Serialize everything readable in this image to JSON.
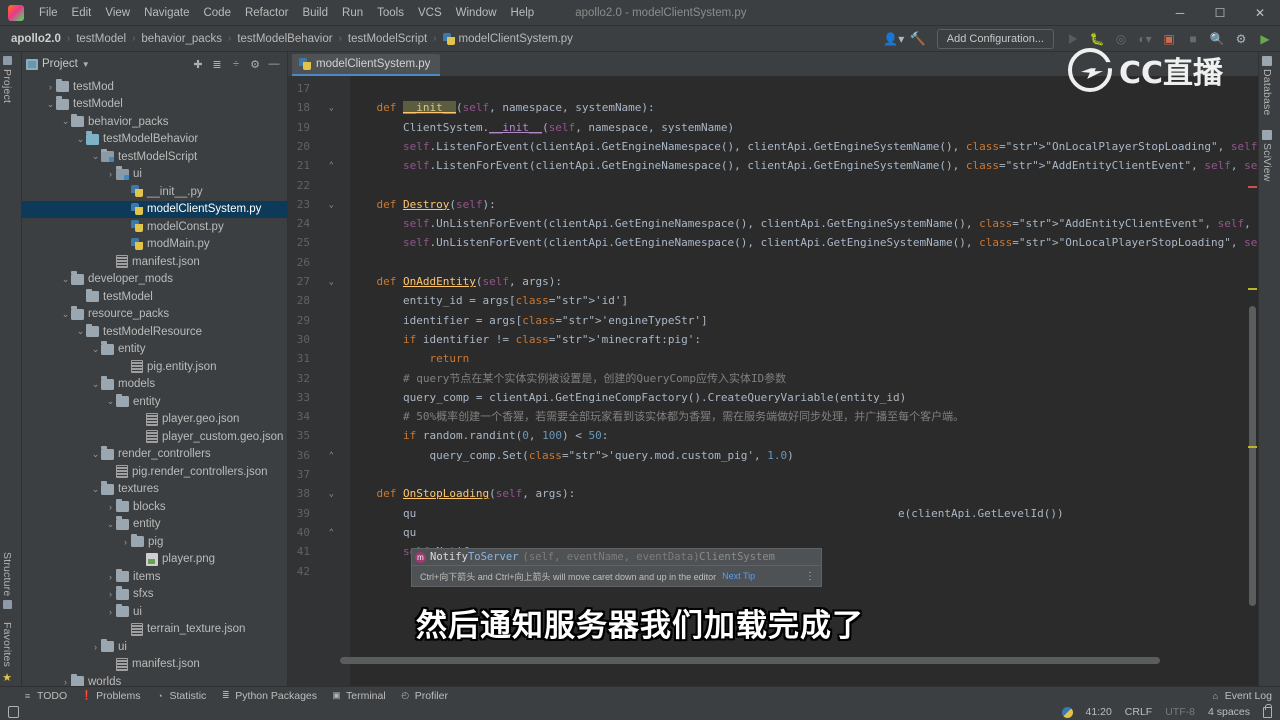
{
  "window": {
    "title": "apollo2.0 - modelClientSystem.py",
    "controls": [
      "─",
      "☐",
      "✕"
    ]
  },
  "menubar": {
    "items": [
      "File",
      "Edit",
      "View",
      "Navigate",
      "Code",
      "Refactor",
      "Build",
      "Run",
      "Tools",
      "VCS",
      "Window",
      "Help"
    ]
  },
  "breadcrumb": {
    "items": [
      "apollo2.0",
      "testModel",
      "behavior_packs",
      "testModelBehavior",
      "testModelScript"
    ],
    "file": "modelClientSystem.py",
    "separator": "›"
  },
  "toolbar": {
    "add_configuration": "Add Configuration...",
    "icons": [
      "user-avatar-icon",
      "hammer-icon",
      "run-icon",
      "debug-icon",
      "coverage-icon",
      "profile-icon",
      "stop-icon",
      "search-icon",
      "settings-icon",
      "plugin-icon"
    ]
  },
  "left_rail": {
    "items": [
      "Project",
      "Structure",
      "Favorites"
    ]
  },
  "right_rail": {
    "items": [
      "Database",
      "SciView"
    ]
  },
  "project_panel": {
    "title": "Project",
    "tools": [
      "scope-icon",
      "collapse-all-icon",
      "flatten-icon",
      "settings-icon",
      "hide-icon"
    ],
    "tree": [
      {
        "label": "testMod",
        "indent": 1,
        "arrow": "›",
        "kind": "folder"
      },
      {
        "label": "testModel",
        "indent": 1,
        "arrow": "∨",
        "kind": "folder"
      },
      {
        "label": "behavior_packs",
        "indent": 2,
        "arrow": "∨",
        "kind": "folder"
      },
      {
        "label": "testModelBehavior",
        "indent": 3,
        "arrow": "∨",
        "kind": "folder-blue"
      },
      {
        "label": "testModelScript",
        "indent": 4,
        "arrow": "∨",
        "kind": "folder-mod"
      },
      {
        "label": "ui",
        "indent": 5,
        "arrow": "›",
        "kind": "folder-mod"
      },
      {
        "label": "__init__.py",
        "indent": 6,
        "arrow": "",
        "kind": "py"
      },
      {
        "label": "modelClientSystem.py",
        "indent": 6,
        "arrow": "",
        "kind": "py",
        "selected": true
      },
      {
        "label": "modelConst.py",
        "indent": 6,
        "arrow": "",
        "kind": "py"
      },
      {
        "label": "modMain.py",
        "indent": 6,
        "arrow": "",
        "kind": "py"
      },
      {
        "label": "manifest.json",
        "indent": 5,
        "arrow": "",
        "kind": "json"
      },
      {
        "label": "developer_mods",
        "indent": 2,
        "arrow": "∨",
        "kind": "folder"
      },
      {
        "label": "testModel",
        "indent": 3,
        "arrow": "",
        "kind": "folder"
      },
      {
        "label": "resource_packs",
        "indent": 2,
        "arrow": "∨",
        "kind": "folder"
      },
      {
        "label": "testModelResource",
        "indent": 3,
        "arrow": "∨",
        "kind": "folder"
      },
      {
        "label": "entity",
        "indent": 4,
        "arrow": "∨",
        "kind": "folder"
      },
      {
        "label": "pig.entity.json",
        "indent": 6,
        "arrow": "",
        "kind": "json"
      },
      {
        "label": "models",
        "indent": 4,
        "arrow": "∨",
        "kind": "folder"
      },
      {
        "label": "entity",
        "indent": 5,
        "arrow": "∨",
        "kind": "folder"
      },
      {
        "label": "player.geo.json",
        "indent": 7,
        "arrow": "",
        "kind": "json"
      },
      {
        "label": "player_custom.geo.json",
        "indent": 7,
        "arrow": "",
        "kind": "json"
      },
      {
        "label": "render_controllers",
        "indent": 4,
        "arrow": "∨",
        "kind": "folder"
      },
      {
        "label": "pig.render_controllers.json",
        "indent": 5,
        "arrow": "",
        "kind": "json"
      },
      {
        "label": "textures",
        "indent": 4,
        "arrow": "∨",
        "kind": "folder"
      },
      {
        "label": "blocks",
        "indent": 5,
        "arrow": "›",
        "kind": "folder"
      },
      {
        "label": "entity",
        "indent": 5,
        "arrow": "∨",
        "kind": "folder"
      },
      {
        "label": "pig",
        "indent": 6,
        "arrow": "›",
        "kind": "folder"
      },
      {
        "label": "player.png",
        "indent": 7,
        "arrow": "",
        "kind": "png"
      },
      {
        "label": "items",
        "indent": 5,
        "arrow": "›",
        "kind": "folder"
      },
      {
        "label": "sfxs",
        "indent": 5,
        "arrow": "›",
        "kind": "folder"
      },
      {
        "label": "ui",
        "indent": 5,
        "arrow": "›",
        "kind": "folder"
      },
      {
        "label": "terrain_texture.json",
        "indent": 6,
        "arrow": "",
        "kind": "json"
      },
      {
        "label": "ui",
        "indent": 4,
        "arrow": "›",
        "kind": "folder"
      },
      {
        "label": "manifest.json",
        "indent": 5,
        "arrow": "",
        "kind": "json"
      },
      {
        "label": "worlds",
        "indent": 2,
        "arrow": "›",
        "kind": "folder"
      }
    ]
  },
  "editor": {
    "tab": "modelClientSystem.py",
    "first_line": 17,
    "lines": [
      {
        "n": 17,
        "text": "",
        "fold": ""
      },
      {
        "n": 18,
        "text": "    def __init__(self, namespace, systemName):",
        "fold": "⌄"
      },
      {
        "n": 19,
        "text": "        ClientSystem.__init__(self, namespace, systemName)",
        "fold": ""
      },
      {
        "n": 20,
        "text": "        self.ListenForEvent(clientApi.GetEngineNamespace(), clientApi.GetEngineSystemName(), \"OnLocalPlayerStopLoading\", self, self.OnStopLoading)",
        "fold": ""
      },
      {
        "n": 21,
        "text": "        self.ListenForEvent(clientApi.GetEngineNamespace(), clientApi.GetEngineSystemName(), \"AddEntityClientEvent\", self, self.OnAddEntity)",
        "fold": "⌃"
      },
      {
        "n": 22,
        "text": "",
        "fold": ""
      },
      {
        "n": 23,
        "text": "    def Destroy(self):",
        "fold": "⌄"
      },
      {
        "n": 24,
        "text": "        self.UnListenForEvent(clientApi.GetEngineNamespace(), clientApi.GetEngineSystemName(), \"AddEntityClientEvent\", self, self.OnAddEntity)",
        "fold": ""
      },
      {
        "n": 25,
        "text": "        self.UnListenForEvent(clientApi.GetEngineNamespace(), clientApi.GetEngineSystemName(), \"OnLocalPlayerStopLoading\", self, self.OnStopLoading)",
        "fold": ""
      },
      {
        "n": 26,
        "text": "",
        "fold": ""
      },
      {
        "n": 27,
        "text": "    def OnAddEntity(self, args):",
        "fold": "⌄"
      },
      {
        "n": 28,
        "text": "        entity_id = args['id']",
        "fold": ""
      },
      {
        "n": 29,
        "text": "        identifier = args['engineTypeStr']",
        "fold": ""
      },
      {
        "n": 30,
        "text": "        if identifier != 'minecraft:pig':",
        "fold": ""
      },
      {
        "n": 31,
        "text": "            return",
        "fold": ""
      },
      {
        "n": 32,
        "text": "        # query节点在某个实体实例被设置是，创建的QueryComp应传入实体ID参数",
        "fold": ""
      },
      {
        "n": 33,
        "text": "        query_comp = clientApi.GetEngineCompFactory().CreateQueryVariable(entity_id)",
        "fold": ""
      },
      {
        "n": 34,
        "text": "        # 50%概率创建一个香猩，若需要全部玩家看到该实体都为香猩，需在服务端做好同步处理，并广播至每个客户端。",
        "fold": ""
      },
      {
        "n": 35,
        "text": "        if random.randint(0, 100) < 50:",
        "fold": ""
      },
      {
        "n": 36,
        "text": "            query_comp.Set('query.mod.custom_pig', 1.0)",
        "fold": "⌃"
      },
      {
        "n": 37,
        "text": "",
        "fold": ""
      },
      {
        "n": 38,
        "text": "    def OnStopLoading(self, args):",
        "fold": "⌄"
      },
      {
        "n": 39,
        "text": "        qu",
        "fold": ""
      },
      {
        "n": 40,
        "text": "        qu",
        "fold": "⌃"
      },
      {
        "n": 41,
        "text": "        self.Notify",
        "fold": ""
      },
      {
        "n": 42,
        "text": "",
        "fold": ""
      }
    ],
    "partial_line_39_tail": "e(clientApi.GetLevelId())"
  },
  "autocomplete": {
    "badge": "m",
    "prefix": "Notify",
    "suffix": "ToServer",
    "signature": "(self, eventName, eventData)",
    "owner": "ClientSystem"
  },
  "tip": {
    "text": "Ctrl+向下箭头 and Ctrl+向上箭头 will move caret down and up in the editor",
    "next": "Next Tip",
    "menu": "⋮"
  },
  "watermark": {
    "text": "CC直播"
  },
  "subtitle": {
    "text": "然后通知服务器我们加载完成了"
  },
  "bottom_bar": {
    "items": [
      {
        "label": "TODO",
        "icon": "list-icon",
        "glyph": "≡"
      },
      {
        "label": "Problems",
        "icon": "warning-icon",
        "glyph": "❗"
      },
      {
        "label": "Statistic",
        "icon": "refresh-icon",
        "glyph": "◔"
      },
      {
        "label": "Python Packages",
        "icon": "packages-icon",
        "glyph": "≣"
      },
      {
        "label": "Terminal",
        "icon": "terminal-icon",
        "glyph": "▣"
      },
      {
        "label": "Profiler",
        "icon": "profiler-icon",
        "glyph": "◴"
      }
    ],
    "event_log": "Event Log",
    "event_log_icon": "bell-icon"
  },
  "statusbar": {
    "caret_position": "41:20",
    "line_separator": "CRLF",
    "encoding": "UTF-8",
    "indent": "4 spaces",
    "lock_icon": "lock-icon",
    "branch_icon": "python-interpreter-icon"
  },
  "colors": {
    "panel_bg": "#3c3f41",
    "editor_bg": "#2b2b2b",
    "gutter_bg": "#313335",
    "selection": "#0d3a58",
    "tab_accent": "#4a88c7",
    "string": "#6a8759",
    "keyword": "#cc7832",
    "function": "#ffc66d",
    "self": "#94558d",
    "number": "#6897bb",
    "comment": "#808080"
  }
}
